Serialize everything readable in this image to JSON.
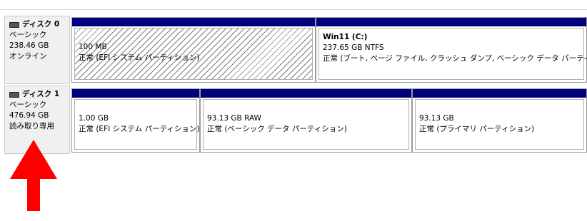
{
  "disks": [
    {
      "title": "ディスク 0",
      "type": "ベーシック",
      "size": "238.46 GB",
      "status": "オンライン",
      "partitions": [
        {
          "name": "",
          "size": "100 MB",
          "desc": "正常 (EFI システム パーティション)"
        },
        {
          "name": "Win11  (C:)",
          "size": "237.65 GB NTFS",
          "desc": "正常 (ブート, ページ ファイル, クラッシュ ダンプ, ベーシック データ パーティション"
        }
      ]
    },
    {
      "title": "ディスク 1",
      "type": "ベーシック",
      "size": "476.94 GB",
      "status": "読み取り専用",
      "partitions": [
        {
          "size": "1.00 GB",
          "desc": "正常 (EFI システム パーティション)"
        },
        {
          "size": "93.13 GB RAW",
          "desc": "正常 (ベーシック データ パーティション)"
        },
        {
          "size": "93.13 GB",
          "desc": "正常 (プライマリ パーティション)"
        }
      ]
    }
  ],
  "colors": {
    "partition_bar": "#00007f",
    "arrow": "#ff0000"
  }
}
